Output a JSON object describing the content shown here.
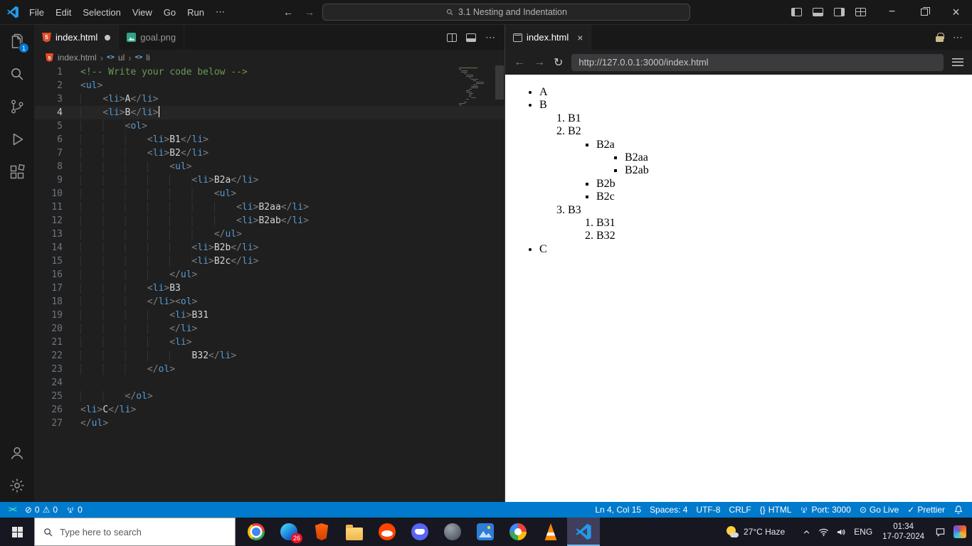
{
  "window": {
    "menus": [
      "File",
      "Edit",
      "Selection",
      "View",
      "Go",
      "Run"
    ],
    "menu_more": "⋯",
    "command_center": "3.1 Nesting and Indentation"
  },
  "activity_bar": {
    "top_icons": [
      "explorer",
      "search",
      "source-control",
      "run-debug",
      "extensions"
    ],
    "bottom_icons": [
      "account",
      "settings"
    ],
    "explorer_badge": "1"
  },
  "editor": {
    "tabs": [
      {
        "label": "index.html",
        "icon": "html",
        "modified": true,
        "active": true
      },
      {
        "label": "goal.png",
        "icon": "image",
        "modified": false,
        "active": false
      }
    ],
    "breadcrumb": [
      {
        "label": "index.html",
        "icon": "html"
      },
      {
        "label": "ul",
        "icon": "symbol"
      },
      {
        "label": "li",
        "icon": "symbol"
      }
    ],
    "cursor": {
      "line": 4,
      "col": 15
    },
    "code_lines": [
      "<!-- Write your code below -->",
      "<ul>",
      "    <li>A</li>",
      "    <li>B</li>",
      "        <ol>",
      "            <li>B1</li>",
      "            <li>B2</li>",
      "                <ul>",
      "                    <li>B2a</li>",
      "                        <ul>",
      "                            <li>B2aa</li>",
      "                            <li>B2ab</li>",
      "                        </ul>",
      "                    <li>B2b</li>",
      "                    <li>B2c</li>",
      "                </ul>",
      "            <li>B3",
      "            </li><ol>",
      "                <li>B31",
      "                </li>",
      "                <li>",
      "                    B32</li>",
      "            </ol>",
      "",
      "        </ol>",
      "<li>C</li>",
      "</ul>"
    ]
  },
  "browser": {
    "tab_label": "index.html",
    "url": "http://127.0.0.1:3000/index.html",
    "rendered": {
      "type": "ul",
      "style": "disc",
      "items": [
        {
          "text": "A"
        },
        {
          "text": "B",
          "children": [
            {
              "type": "ol",
              "style": "decimal",
              "items": [
                {
                  "text": "B1"
                },
                {
                  "text": "B2",
                  "children": [
                    {
                      "type": "ul",
                      "style": "square",
                      "items": [
                        {
                          "text": "B2a",
                          "children": [
                            {
                              "type": "ul",
                              "style": "square",
                              "items": [
                                {
                                  "text": "B2aa"
                                },
                                {
                                  "text": "B2ab"
                                }
                              ]
                            }
                          ]
                        },
                        {
                          "text": "B2b"
                        },
                        {
                          "text": "B2c"
                        }
                      ]
                    }
                  ]
                },
                {
                  "text": "B3",
                  "children": [
                    {
                      "type": "ol",
                      "style": "decimal",
                      "items": [
                        {
                          "text": "B31"
                        },
                        {
                          "text": "B32"
                        }
                      ]
                    }
                  ]
                }
              ]
            }
          ]
        },
        {
          "text": "C"
        }
      ]
    }
  },
  "status_bar": {
    "errors": "0",
    "warnings": "0",
    "ports": "0",
    "items_right": [
      {
        "name": "cursor-position",
        "label": "Ln 4, Col 15"
      },
      {
        "name": "indentation",
        "label": "Spaces: 4"
      },
      {
        "name": "encoding",
        "label": "UTF-8"
      },
      {
        "name": "eol",
        "label": "CRLF"
      },
      {
        "name": "language-mode",
        "label": "HTML",
        "icon": "braces"
      },
      {
        "name": "port",
        "label": "Port: 3000",
        "icon": "tower"
      },
      {
        "name": "go-live",
        "label": "Go Live",
        "icon": "broadcast"
      },
      {
        "name": "prettier",
        "label": "Prettier",
        "icon": "check"
      }
    ]
  },
  "taskbar": {
    "search_placeholder": "Type here to search",
    "apps": [
      {
        "app": "chrome"
      },
      {
        "app": "edge",
        "badge": "26"
      },
      {
        "app": "brave"
      },
      {
        "app": "file-explorer"
      },
      {
        "app": "reddit"
      },
      {
        "app": "discord"
      },
      {
        "app": "github-desktop"
      },
      {
        "app": "photos"
      },
      {
        "app": "google"
      },
      {
        "app": "vlc"
      },
      {
        "app": "vscode",
        "active": true
      }
    ],
    "weather_label": "27°C Haze",
    "lang": "ENG",
    "clock": {
      "time": "01:34",
      "date": "17-07-2024"
    }
  }
}
